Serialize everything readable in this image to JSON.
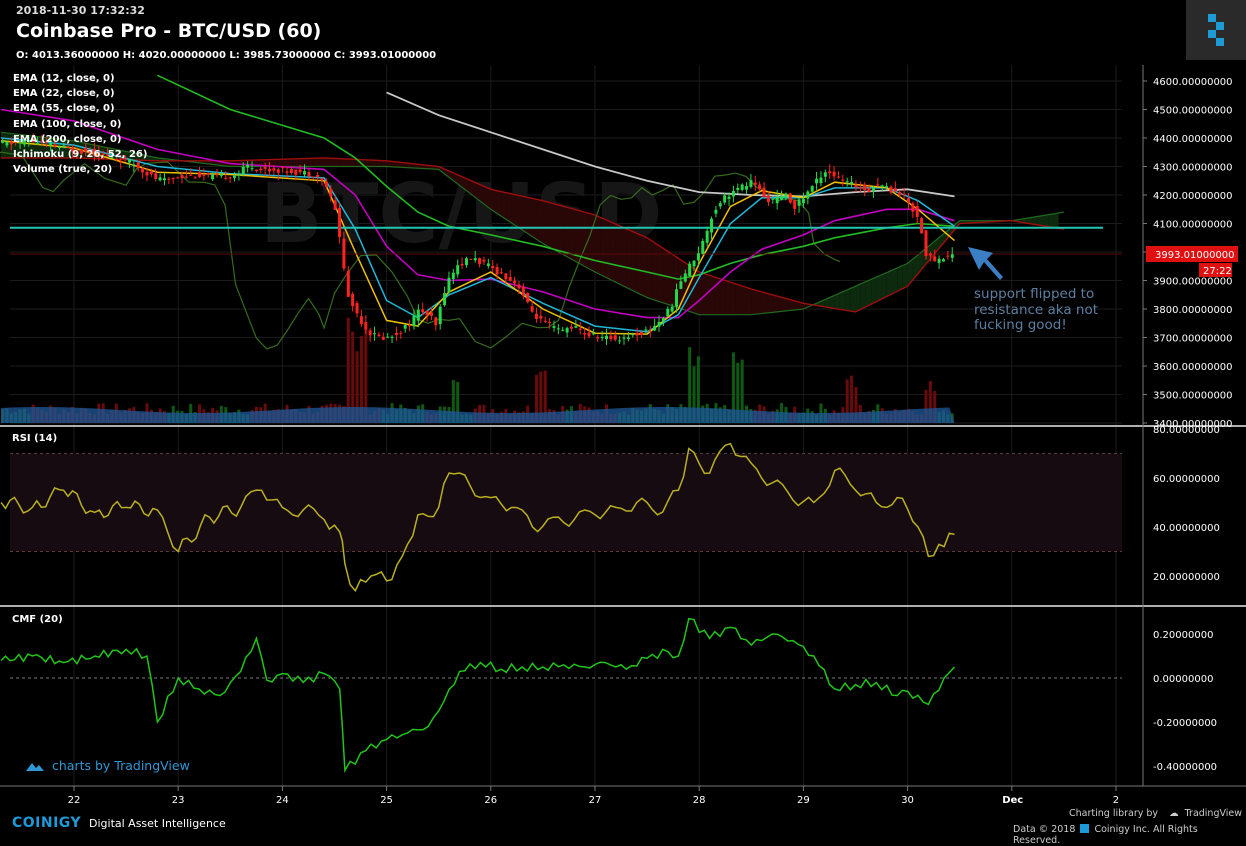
{
  "header": {
    "timestamp": "2018-11-30 17:32:32",
    "title": "Coinbase Pro - BTC/USD (60)",
    "ohlc": "O: 4013.36000000 H: 4020.00000000 L: 3985.73000000 C: 3993.01000000",
    "watermark": "BTC/USD"
  },
  "legend": [
    "EMA (12, close, 0)",
    "EMA (22, close, 0)",
    "EMA (55, close, 0)",
    "EMA (100, close, 0)",
    "EMA (200, close, 0)",
    "Ichimoku (9, 26, 52, 26)",
    "Volume (true, 20)"
  ],
  "annotation": "support flipped to resistance aka not fucking good!",
  "footer": {
    "tradingview_watermark": "charts by TradingView",
    "brand": "COINIGY",
    "tagline": "Digital Asset Intelligence",
    "charting_library": "Charting library by",
    "tradingview": "TradingView",
    "copyright": "Data © 2018",
    "copyright2": "Coinigy Inc. All Rights Reserved."
  },
  "colors": {
    "bull": "#26d94a",
    "bear": "#ff2222",
    "ema12": "#f0c000",
    "ema22": "#1fb8d8",
    "ema55": "#c200c2",
    "ema100": "#22bb22",
    "ema200": "#c8c8c8",
    "support_line": "#22c3b0",
    "rsi": "#b8b020",
    "cmf": "#22c41a",
    "price_tag": "#e01010",
    "arrow": "#3a7ec4"
  },
  "chart_data": [
    {
      "type": "candlestick",
      "pane": "price",
      "ylim": [
        3400,
        4650
      ],
      "y_ticks": [
        "4600.00000000",
        "4500.00000000",
        "4400.00000000",
        "4300.00000000",
        "4200.00000000",
        "4100.00000000",
        "4000.00000000",
        "3900.00000000",
        "3800.00000000",
        "3700.00000000",
        "3600.00000000",
        "3500.00000000",
        "3400.00000000"
      ],
      "x_ticks": [
        "22",
        "23",
        "24",
        "25",
        "26",
        "27",
        "28",
        "29",
        "30",
        "Dec",
        "2"
      ],
      "last_price": 3993.01,
      "last_price_label": "3993.01000000",
      "countdown_label": "27:22",
      "support_resistance_level": 4085,
      "close_path": [
        [
          21.4,
          4380
        ],
        [
          21.6,
          4390
        ],
        [
          21.8,
          4375
        ],
        [
          22.0,
          4360
        ],
        [
          22.2,
          4350
        ],
        [
          22.4,
          4330
        ],
        [
          22.6,
          4310
        ],
        [
          22.8,
          4260
        ],
        [
          22.9,
          4250
        ],
        [
          23.0,
          4265
        ],
        [
          23.2,
          4270
        ],
        [
          23.4,
          4262
        ],
        [
          23.6,
          4272
        ],
        [
          23.7,
          4305
        ],
        [
          23.8,
          4290
        ],
        [
          24.0,
          4288
        ],
        [
          24.2,
          4280
        ],
        [
          24.35,
          4272
        ],
        [
          24.45,
          4230
        ],
        [
          24.55,
          4130
        ],
        [
          24.65,
          3850
        ],
        [
          24.75,
          3780
        ],
        [
          24.85,
          3720
        ],
        [
          24.95,
          3700
        ],
        [
          25.05,
          3700
        ],
        [
          25.15,
          3720
        ],
        [
          25.25,
          3750
        ],
        [
          25.35,
          3800
        ],
        [
          25.45,
          3770
        ],
        [
          25.5,
          3740
        ],
        [
          25.6,
          3890
        ],
        [
          25.7,
          3950
        ],
        [
          25.85,
          3980
        ],
        [
          26.0,
          3950
        ],
        [
          26.15,
          3920
        ],
        [
          26.3,
          3880
        ],
        [
          26.4,
          3800
        ],
        [
          26.5,
          3760
        ],
        [
          26.6,
          3740
        ],
        [
          26.7,
          3720
        ],
        [
          26.8,
          3740
        ],
        [
          26.95,
          3710
        ],
        [
          27.1,
          3700
        ],
        [
          27.25,
          3695
        ],
        [
          27.4,
          3710
        ],
        [
          27.55,
          3725
        ],
        [
          27.65,
          3760
        ],
        [
          27.75,
          3800
        ],
        [
          27.85,
          3900
        ],
        [
          27.95,
          3960
        ],
        [
          28.05,
          4020
        ],
        [
          28.15,
          4130
        ],
        [
          28.25,
          4190
        ],
        [
          28.35,
          4210
        ],
        [
          28.45,
          4230
        ],
        [
          28.55,
          4250
        ],
        [
          28.65,
          4190
        ],
        [
          28.75,
          4180
        ],
        [
          28.85,
          4200
        ],
        [
          28.95,
          4160
        ],
        [
          29.05,
          4200
        ],
        [
          29.15,
          4250
        ],
        [
          29.25,
          4290
        ],
        [
          29.35,
          4260
        ],
        [
          29.45,
          4240
        ],
        [
          29.55,
          4230
        ],
        [
          29.65,
          4220
        ],
        [
          29.75,
          4240
        ],
        [
          29.85,
          4220
        ],
        [
          29.95,
          4210
        ],
        [
          30.05,
          4170
        ],
        [
          30.15,
          4100
        ],
        [
          30.2,
          3990
        ],
        [
          30.3,
          3970
        ],
        [
          30.4,
          3985
        ],
        [
          30.45,
          3993
        ]
      ],
      "ema12": [
        [
          21.3,
          4390
        ],
        [
          22.0,
          4365
        ],
        [
          22.8,
          4280
        ],
        [
          23.5,
          4272
        ],
        [
          24.4,
          4250
        ],
        [
          24.7,
          4000
        ],
        [
          25.0,
          3760
        ],
        [
          25.3,
          3740
        ],
        [
          25.6,
          3860
        ],
        [
          26.0,
          3930
        ],
        [
          26.5,
          3800
        ],
        [
          27.0,
          3715
        ],
        [
          27.5,
          3712
        ],
        [
          27.8,
          3800
        ],
        [
          28.0,
          3960
        ],
        [
          28.3,
          4160
        ],
        [
          28.6,
          4215
        ],
        [
          29.0,
          4190
        ],
        [
          29.3,
          4245
        ],
        [
          29.8,
          4225
        ],
        [
          30.1,
          4150
        ],
        [
          30.45,
          4040
        ]
      ],
      "ema22": [
        [
          21.3,
          4400
        ],
        [
          22.0,
          4375
        ],
        [
          22.8,
          4300
        ],
        [
          23.5,
          4275
        ],
        [
          24.4,
          4260
        ],
        [
          24.7,
          4080
        ],
        [
          25.0,
          3830
        ],
        [
          25.3,
          3770
        ],
        [
          25.6,
          3850
        ],
        [
          26.0,
          3910
        ],
        [
          26.5,
          3820
        ],
        [
          27.0,
          3740
        ],
        [
          27.5,
          3720
        ],
        [
          27.8,
          3780
        ],
        [
          28.0,
          3910
        ],
        [
          28.3,
          4100
        ],
        [
          28.6,
          4190
        ],
        [
          29.0,
          4190
        ],
        [
          29.3,
          4225
        ],
        [
          29.8,
          4225
        ],
        [
          30.1,
          4180
        ],
        [
          30.45,
          4090
        ]
      ],
      "ema55": [
        [
          21.3,
          4500
        ],
        [
          22.0,
          4460
        ],
        [
          22.8,
          4360
        ],
        [
          23.5,
          4310
        ],
        [
          24.4,
          4290
        ],
        [
          24.7,
          4200
        ],
        [
          25.0,
          4020
        ],
        [
          25.3,
          3920
        ],
        [
          25.6,
          3900
        ],
        [
          26.0,
          3905
        ],
        [
          26.5,
          3860
        ],
        [
          27.0,
          3800
        ],
        [
          27.5,
          3770
        ],
        [
          27.8,
          3770
        ],
        [
          28.0,
          3830
        ],
        [
          28.3,
          3930
        ],
        [
          28.6,
          4010
        ],
        [
          29.0,
          4060
        ],
        [
          29.3,
          4110
        ],
        [
          29.8,
          4150
        ],
        [
          30.1,
          4150
        ],
        [
          30.45,
          4110
        ]
      ],
      "ema100": [
        [
          22.8,
          4620
        ],
        [
          23.5,
          4500
        ],
        [
          24.4,
          4400
        ],
        [
          24.7,
          4330
        ],
        [
          25.0,
          4230
        ],
        [
          25.3,
          4140
        ],
        [
          25.6,
          4090
        ],
        [
          26.0,
          4060
        ],
        [
          26.5,
          4020
        ],
        [
          27.0,
          3970
        ],
        [
          27.5,
          3930
        ],
        [
          27.8,
          3905
        ],
        [
          28.0,
          3920
        ],
        [
          28.3,
          3960
        ],
        [
          28.6,
          3990
        ],
        [
          29.0,
          4020
        ],
        [
          29.3,
          4050
        ],
        [
          29.8,
          4085
        ],
        [
          30.1,
          4100
        ],
        [
          30.45,
          4090
        ]
      ],
      "ema200": [
        [
          25.0,
          4560
        ],
        [
          25.5,
          4480
        ],
        [
          26.0,
          4420
        ],
        [
          26.5,
          4360
        ],
        [
          27.0,
          4300
        ],
        [
          27.5,
          4250
        ],
        [
          28.0,
          4210
        ],
        [
          28.5,
          4200
        ],
        [
          29.0,
          4195
        ],
        [
          29.5,
          4210
        ],
        [
          30.0,
          4220
        ],
        [
          30.45,
          4195
        ]
      ],
      "ichimoku_cloud_a": [
        [
          21.3,
          4420
        ],
        [
          22.0,
          4390
        ],
        [
          22.8,
          4330
        ],
        [
          23.5,
          4300
        ],
        [
          24.4,
          4300
        ],
        [
          25.0,
          4300
        ],
        [
          25.5,
          4290
        ],
        [
          26.0,
          4150
        ],
        [
          26.5,
          4030
        ],
        [
          27.0,
          3930
        ],
        [
          27.5,
          3840
        ],
        [
          28.0,
          3780
        ],
        [
          28.5,
          3780
        ],
        [
          29.0,
          3800
        ],
        [
          29.5,
          3880
        ],
        [
          30.0,
          3960
        ],
        [
          30.5,
          4110
        ],
        [
          31.0,
          4110
        ],
        [
          31.5,
          4140
        ]
      ],
      "ichimoku_cloud_b": [
        [
          21.3,
          4330
        ],
        [
          22.0,
          4330
        ],
        [
          22.8,
          4320
        ],
        [
          23.5,
          4320
        ],
        [
          24.4,
          4330
        ],
        [
          25.0,
          4320
        ],
        [
          25.5,
          4300
        ],
        [
          26.0,
          4220
        ],
        [
          26.5,
          4180
        ],
        [
          27.0,
          4130
        ],
        [
          27.5,
          4050
        ],
        [
          28.0,
          3930
        ],
        [
          28.5,
          3870
        ],
        [
          29.0,
          3820
        ],
        [
          29.5,
          3790
        ],
        [
          30.0,
          3880
        ],
        [
          30.5,
          4100
        ],
        [
          31.0,
          4110
        ],
        [
          31.5,
          4080
        ]
      ],
      "volume_spikes": [
        [
          24.65,
          120
        ],
        [
          24.75,
          90
        ],
        [
          25.65,
          60
        ],
        [
          26.45,
          80
        ],
        [
          27.95,
          70
        ],
        [
          28.35,
          65
        ],
        [
          29.45,
          45
        ],
        [
          30.2,
          40
        ]
      ]
    },
    {
      "type": "line",
      "pane": "rsi",
      "name": "RSI (14)",
      "ylim": [
        10,
        80
      ],
      "y_ticks": [
        "80.00000000",
        "60.00000000",
        "40.00000000",
        "20.00000000"
      ],
      "band": [
        30,
        70
      ],
      "x": [
        21.3,
        21.6,
        21.9,
        22.2,
        22.5,
        22.8,
        23.0,
        23.3,
        23.6,
        23.8,
        24.0,
        24.2,
        24.4,
        24.55,
        24.6,
        24.7,
        24.85,
        25.0,
        25.15,
        25.3,
        25.5,
        25.6,
        25.8,
        26.0,
        26.2,
        26.4,
        26.6,
        26.8,
        27.0,
        27.2,
        27.4,
        27.6,
        27.8,
        27.9,
        28.1,
        28.3,
        28.5,
        28.7,
        28.9,
        29.1,
        29.3,
        29.5,
        29.7,
        29.9,
        30.1,
        30.2,
        30.35,
        30.45
      ],
      "values": [
        50,
        48,
        55,
        46,
        48,
        47,
        30,
        44,
        48,
        55,
        48,
        47,
        43,
        38,
        25,
        14,
        20,
        18,
        28,
        45,
        48,
        62,
        57,
        52,
        48,
        40,
        44,
        43,
        45,
        48,
        50,
        45,
        55,
        72,
        62,
        74,
        66,
        58,
        51,
        50,
        63,
        55,
        50,
        52,
        40,
        28,
        32,
        37
      ]
    },
    {
      "type": "line",
      "pane": "cmf",
      "name": "CMF (20)",
      "ylim": [
        -0.45,
        0.25
      ],
      "y_ticks": [
        "0.20000000",
        "0.00000000",
        "-0.20000000",
        "-0.40000000"
      ],
      "baseline": 0,
      "x": [
        21.3,
        21.6,
        21.9,
        22.2,
        22.5,
        22.7,
        22.8,
        23.0,
        23.2,
        23.4,
        23.6,
        23.75,
        23.85,
        24.0,
        24.2,
        24.4,
        24.55,
        24.6,
        24.8,
        25.0,
        25.2,
        25.4,
        25.5,
        25.7,
        25.9,
        26.1,
        26.3,
        26.5,
        26.7,
        26.9,
        27.1,
        27.3,
        27.5,
        27.7,
        27.8,
        27.9,
        28.1,
        28.3,
        28.5,
        28.7,
        28.9,
        29.1,
        29.3,
        29.5,
        29.7,
        29.9,
        30.0,
        30.2,
        30.35,
        30.45
      ],
      "values": [
        0.08,
        0.1,
        0.07,
        0.1,
        0.13,
        0.1,
        -0.2,
        0.0,
        -0.05,
        -0.08,
        0.03,
        0.18,
        -0.01,
        0.02,
        -0.02,
        0.02,
        -0.05,
        -0.42,
        -0.33,
        -0.28,
        -0.25,
        -0.22,
        -0.15,
        0.03,
        0.07,
        0.04,
        0.05,
        0.05,
        0.06,
        0.05,
        0.07,
        0.04,
        0.09,
        0.12,
        0.1,
        0.27,
        0.18,
        0.23,
        0.15,
        0.2,
        0.17,
        0.1,
        -0.05,
        -0.03,
        -0.02,
        -0.08,
        -0.06,
        -0.12,
        0.0,
        0.05
      ]
    }
  ]
}
